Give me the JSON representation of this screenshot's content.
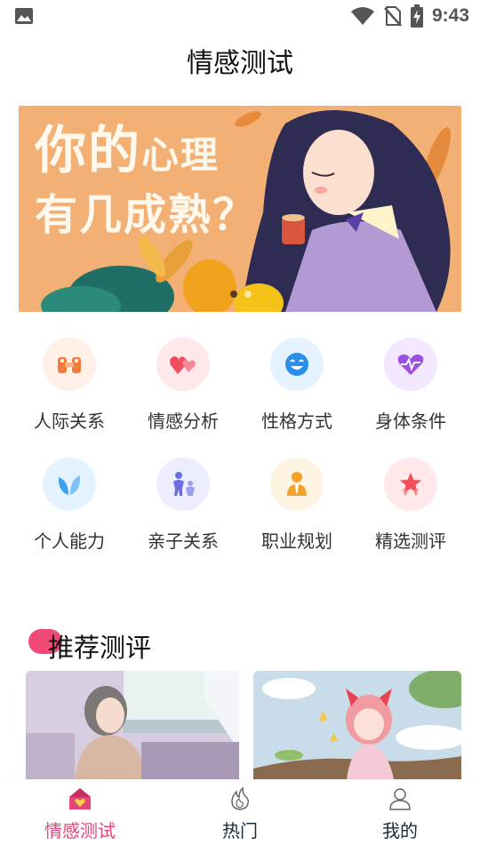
{
  "status_bar": {
    "time": "9:43"
  },
  "header": {
    "title": "情感测试"
  },
  "banner": {
    "line1_big": "你的",
    "line1_small": "心理",
    "line2": "有几成熟？",
    "slides": 2,
    "active_slide": 1
  },
  "categories": [
    {
      "label": "人际关系",
      "icon": "people-icon",
      "bg": "#fff1e8",
      "color": "#f47b3a"
    },
    {
      "label": "情感分析",
      "icon": "hearts-icon",
      "bg": "#ffe8ea",
      "color": "#f04e5e"
    },
    {
      "label": "性格方式",
      "icon": "smiley-icon",
      "bg": "#e4f3ff",
      "color": "#2a8fe8"
    },
    {
      "label": "身体条件",
      "icon": "heartbeat-icon",
      "bg": "#f3e8ff",
      "color": "#9b4fe3"
    },
    {
      "label": "个人能力",
      "icon": "leaf-icon",
      "bg": "#e4f3ff",
      "color": "#3fa0f0"
    },
    {
      "label": "亲子关系",
      "icon": "parent-child-icon",
      "bg": "#eceeff",
      "color": "#6a6fe0"
    },
    {
      "label": "职业规划",
      "icon": "business-person-icon",
      "bg": "#fff4e2",
      "color": "#f3a22c"
    },
    {
      "label": "精选测评",
      "icon": "star-ribbon-icon",
      "bg": "#ffe9ea",
      "color": "#f0505a"
    }
  ],
  "recommend": {
    "title": "推荐测评"
  },
  "tabbar": {
    "items": [
      {
        "label": "情感测试",
        "icon": "home-heart-icon",
        "active": true
      },
      {
        "label": "热门",
        "icon": "flame-icon",
        "active": false
      },
      {
        "label": "我的",
        "icon": "user-icon",
        "active": false
      }
    ]
  },
  "colors": {
    "accent": "#e24777",
    "banner_bg": "#f2b074"
  }
}
